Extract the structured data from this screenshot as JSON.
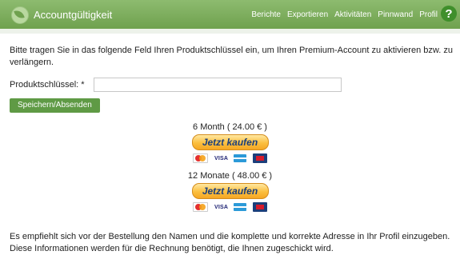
{
  "header": {
    "title": "Accountgültigkeit",
    "nav": [
      "Berichte",
      "Exportieren",
      "Aktivitäten",
      "Pinnwand",
      "Profil"
    ],
    "help": "?"
  },
  "intro_text": "Bitte tragen Sie in das folgende Feld Ihren Produktschlüssel ein, um Ihren Premium-Account zu aktivieren bzw. zu verlängern.",
  "form": {
    "label": "Produktschlüssel: *",
    "value": "",
    "save_label": "Speichern/Absenden"
  },
  "offers": [
    {
      "price_text": "6 Month ( 24.00 € )",
      "button": "Jetzt kaufen",
      "cards": [
        "mastercard-icon",
        "visa-icon",
        "amex-icon",
        "card-icon"
      ]
    },
    {
      "price_text": "12 Monate ( 48.00 € )",
      "button": "Jetzt kaufen",
      "cards": [
        "mastercard-icon",
        "visa-icon",
        "amex-icon",
        "card-icon"
      ]
    }
  ],
  "footer_text": "Es empfiehlt sich vor der Bestellung den Namen und die komplette und korrekte Adresse in Ihr Profil einzugeben. Diese Informationen werden für die Rechnung benötigt, die Ihnen zugeschickt wird.",
  "visa_text": "VISA",
  "colors": {
    "header": "#6fa14e",
    "button": "#5f9a45",
    "paypal": "#fbbf3f"
  }
}
